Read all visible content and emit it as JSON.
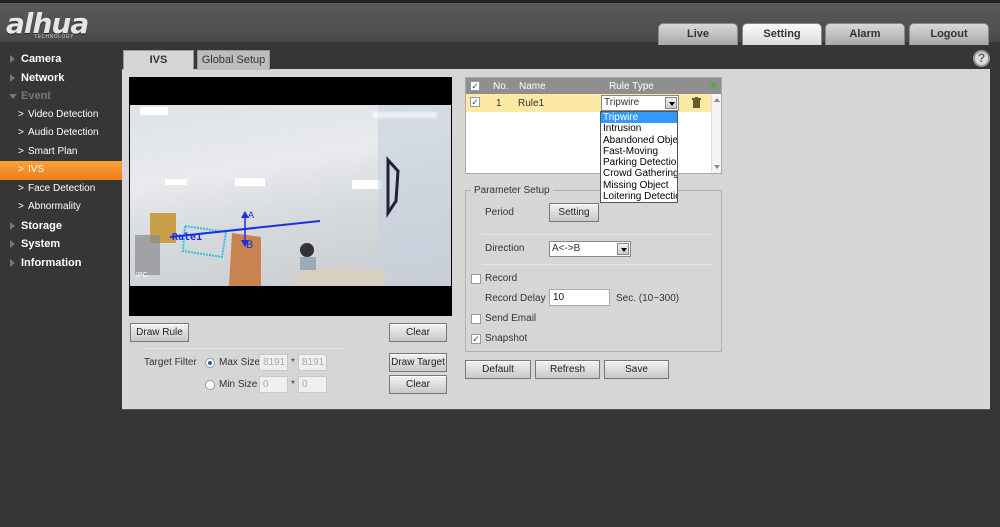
{
  "header": {
    "logo_text": "alhua",
    "logo_sub": "TECHNOLOGY",
    "tabs": [
      {
        "label": "Live",
        "active": false
      },
      {
        "label": "Setting",
        "active": true
      },
      {
        "label": "Alarm",
        "active": false
      },
      {
        "label": "Logout",
        "active": false
      }
    ],
    "help_icon": "?"
  },
  "sidebar": {
    "items": [
      {
        "label": "Camera",
        "level": 1
      },
      {
        "label": "Network",
        "level": 1
      },
      {
        "label": "Event",
        "level": 1,
        "open": true
      },
      {
        "label": "Video Detection",
        "level": 2
      },
      {
        "label": "Audio Detection",
        "level": 2
      },
      {
        "label": "Smart Plan",
        "level": 2
      },
      {
        "label": "IVS",
        "level": 2,
        "active": true
      },
      {
        "label": "Face Detection",
        "level": 2
      },
      {
        "label": "Abnormality",
        "level": 2
      },
      {
        "label": "Storage",
        "level": 1
      },
      {
        "label": "System",
        "level": 1
      },
      {
        "label": "Information",
        "level": 1
      }
    ],
    "chevron": ">"
  },
  "subtabs": {
    "ivs": "IVS",
    "global": "Global Setup"
  },
  "video": {
    "rule_label": "Rule1",
    "point_a": "A",
    "point_b": "B",
    "channel_label": "IPC",
    "line_color": "#1a2ee6"
  },
  "left_controls": {
    "draw_rule": "Draw Rule",
    "clear1": "Clear",
    "target_filter_label": "Target Filter",
    "max_size_label": "Max Size",
    "max_w": "8191",
    "max_h": "8191",
    "min_size_label": "Min Size",
    "min_w": "0",
    "min_h": "0",
    "times": "*",
    "draw_target": "Draw Target",
    "clear2": "Clear",
    "selected_filter": "Max Size"
  },
  "rules_table": {
    "headers": {
      "no": "No.",
      "name": "Name",
      "type": "Rule Type"
    },
    "rows": [
      {
        "checked": true,
        "no": "1",
        "name": "Rule1",
        "type": "Tripwire"
      }
    ],
    "add_icon": "+",
    "delete_icon": "trash"
  },
  "rule_type_options": [
    "Tripwire",
    "Intrusion",
    "Abandoned Object",
    "Fast-Moving",
    "Parking Detection",
    "Crowd Gathering Estimation",
    "Missing Object",
    "Loitering Detection"
  ],
  "parameter_setup": {
    "legend": "Parameter Setup",
    "period_label": "Period",
    "period_button": "Setting",
    "direction_label": "Direction",
    "direction_value": "A<->B",
    "record_label": "Record",
    "record_checked": false,
    "record_delay_label": "Record Delay",
    "record_delay_value": "10",
    "record_delay_hint": "Sec. (10~300)",
    "send_email_label": "Send Email",
    "send_email_checked": false,
    "snapshot_label": "Snapshot",
    "snapshot_checked": true
  },
  "footer_buttons": {
    "default": "Default",
    "refresh": "Refresh",
    "save": "Save"
  },
  "colors": {
    "accent": "#f39a2c",
    "row_highlight": "#fde9a6",
    "selection": "#3399ff"
  }
}
